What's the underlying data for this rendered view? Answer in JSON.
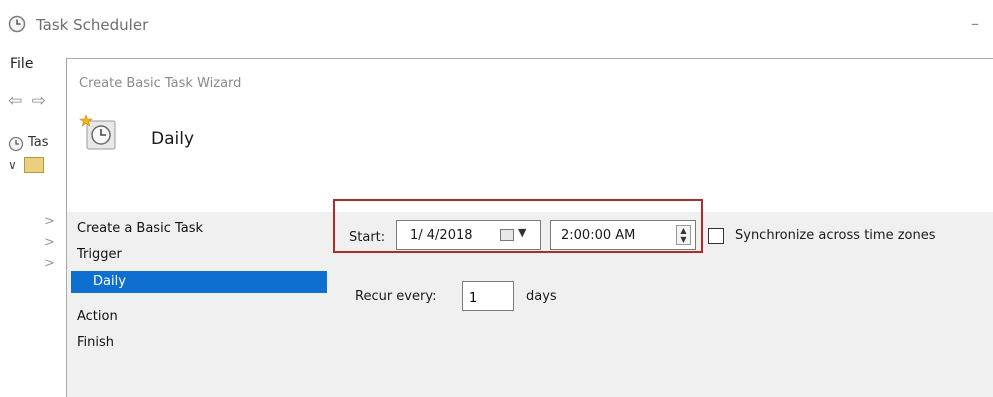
{
  "app": {
    "title": "Task Scheduler",
    "menu_file": "File",
    "nav_arrows": "⇦ ⇨",
    "minimize_glyph": "–",
    "tree_label": "Tas",
    "tree_chevron": "✓",
    "tree_arrows": [
      ">",
      ">",
      ">"
    ]
  },
  "wizard": {
    "title": "Create Basic Task Wizard",
    "heading": "Daily",
    "steps": [
      "Create a Basic Task",
      "Trigger",
      "Daily",
      "Action",
      "Finish"
    ],
    "selected_step": "Daily",
    "start_label": "Start:",
    "start_date": "1/ 4/2018",
    "start_time": "2:00:00 AM",
    "sync_label": "Synchronize across time zones",
    "sync_checked": false,
    "recur_label": "Recur every:",
    "recur_value": "1",
    "recur_unit": "days"
  },
  "colors": {
    "selection": "#0f6fd1",
    "highlight_border": "#b22b2b",
    "panel_bg": "#f0f0f0"
  },
  "icons": {
    "app": "clock-icon",
    "wizard_header": "scheduled-task-clock-icon",
    "calendar": "calendar-icon",
    "spinner": "spin-up-down-icon"
  }
}
